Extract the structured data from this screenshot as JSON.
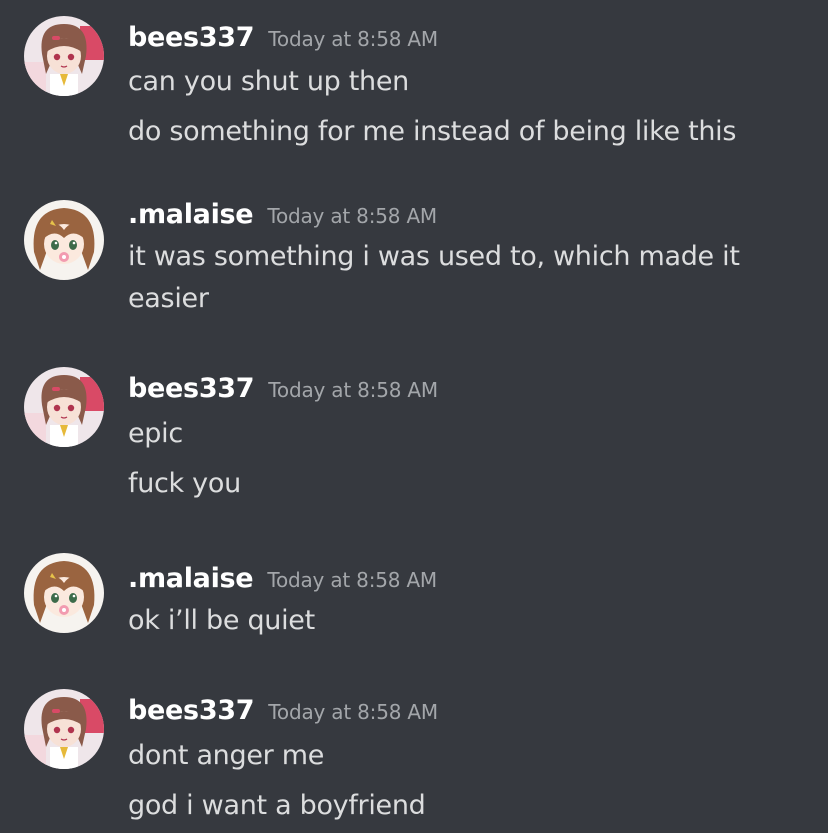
{
  "messages": [
    {
      "author": "bees337",
      "timestamp": "Today at 8:58 AM",
      "lines": [
        "can you shut up then",
        "do something for me instead of being like this"
      ]
    },
    {
      "author": ".malaise",
      "timestamp": "Today at 8:58 AM",
      "lines": [
        "it was something i was used to, which made it",
        "easier"
      ]
    },
    {
      "author": "bees337",
      "timestamp": "Today at 8:58 AM",
      "lines": [
        "epic",
        "fuck you"
      ]
    },
    {
      "author": ".malaise",
      "timestamp": "Today at 8:58 AM",
      "lines": [
        "ok i’ll be quiet"
      ]
    },
    {
      "author": "bees337",
      "timestamp": "Today at 8:58 AM",
      "lines": [
        "dont anger me",
        "god i want a boyfriend"
      ]
    }
  ],
  "colors": {
    "background": "#36393f",
    "username": "#ffffff",
    "timestamp": "#a3a6aa",
    "message_text": "#dcddde"
  }
}
